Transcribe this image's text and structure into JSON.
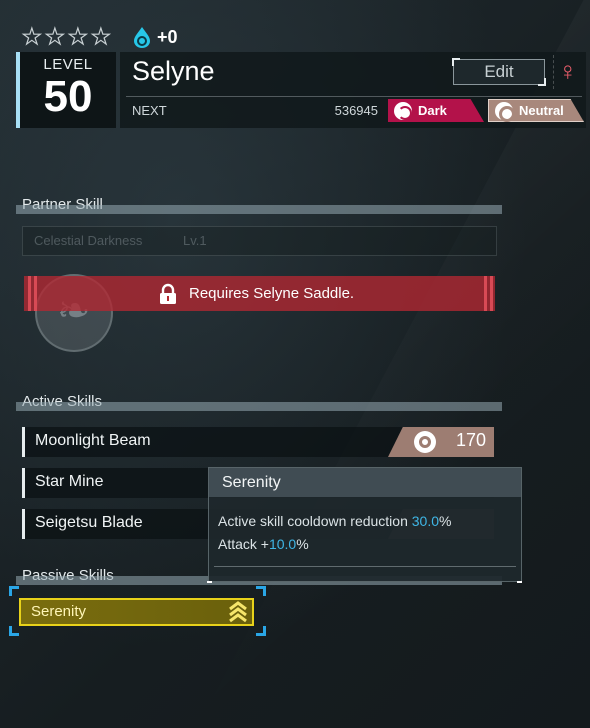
{
  "header": {
    "stars_count": 4,
    "condenser_bonus": "+0",
    "level_label": "LEVEL",
    "level_value": "50",
    "pal_name": "Selyne",
    "edit_label": "Edit",
    "gender_symbol": "♀",
    "next_label": "NEXT",
    "next_value": "536945",
    "types": [
      {
        "label": "Dark",
        "color": "#b3124a",
        "icon": "dark-element-icon"
      },
      {
        "label": "Neutral",
        "color": "#a8887c",
        "icon": "neutral-element-icon"
      }
    ]
  },
  "partner_skill": {
    "section_title": "Partner Skill",
    "skill_name": "Celestial Darkness",
    "skill_level": "Lv.1",
    "lock_message": "Requires Selyne Saddle."
  },
  "active_skills": {
    "section_title": "Active Skills",
    "items": [
      {
        "name": "Moonlight Beam",
        "power": "170",
        "element_icon": "neutral-element-icon"
      },
      {
        "name": "Star Mine"
      },
      {
        "name": "Seigetsu Blade"
      }
    ]
  },
  "tooltip": {
    "title": "Serenity",
    "line1_prefix": "Active skill cooldown reduction ",
    "line1_value": "30.0",
    "line1_suffix": "%",
    "line2_prefix": "Attack +",
    "line2_value": "10.0",
    "line2_suffix": "%"
  },
  "passive_skills": {
    "section_title": "Passive Skills",
    "items": [
      {
        "name": "Serenity",
        "rank_icon": "rank-up-chevrons-icon"
      }
    ]
  },
  "colors": {
    "accent_blue": "#2aa6e6",
    "passive_gold": "#e8d21a",
    "lock_red": "#b4282f",
    "gender_pink": "#e85d6a"
  }
}
